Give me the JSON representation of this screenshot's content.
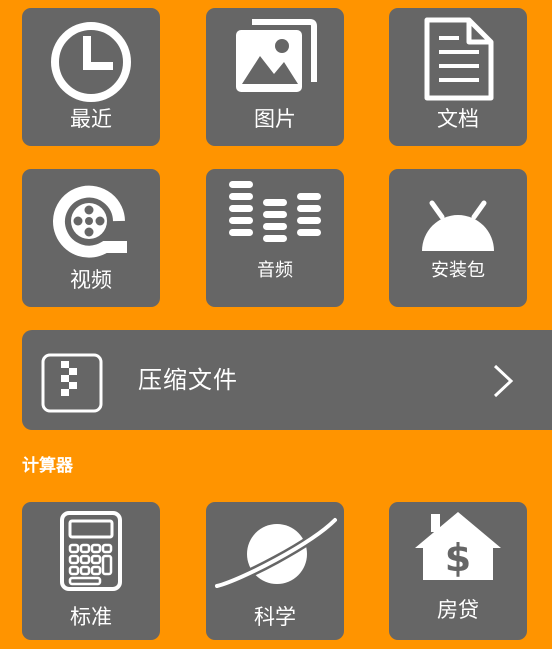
{
  "colors": {
    "background": "#FF9400",
    "tile": "#666666",
    "foreground": "#FFFFFF"
  },
  "categories": {
    "recent": {
      "label": "最近",
      "icon": "clock-icon"
    },
    "images": {
      "label": "图片",
      "icon": "image-gallery-icon"
    },
    "docs": {
      "label": "文档",
      "icon": "document-icon"
    },
    "video": {
      "label": "视频",
      "icon": "film-reel-icon"
    },
    "audio": {
      "label": "音频",
      "icon": "equalizer-icon"
    },
    "apk": {
      "label": "安装包",
      "icon": "android-icon"
    }
  },
  "archive": {
    "label": "压缩文件",
    "icon": "zip-archive-icon",
    "chevron": "chevron-right-icon"
  },
  "calculator": {
    "heading": "计算器",
    "items": {
      "standard": {
        "label": "标准",
        "icon": "calculator-icon"
      },
      "scientific": {
        "label": "科学",
        "icon": "planet-icon"
      },
      "mortgage": {
        "label": "房贷",
        "icon": "house-dollar-icon"
      }
    }
  }
}
